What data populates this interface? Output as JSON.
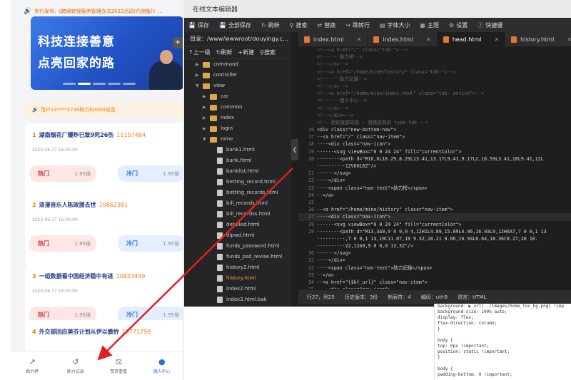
{
  "mobile": {
    "notice": "央行发布:《跨境转接服务管理办法2022活动(内测版)》...",
    "banner": {
      "line1": "科技连接善意",
      "line2": "点亮回家的路"
    },
    "winner": "用户13****2749助力60000成金",
    "cards": [
      {
        "num": "1",
        "title": "湖南烟花厂爆炸已致9死26伤",
        "hot": "11157484",
        "time": "2025-06-17 16:30:00",
        "left_label": "热门",
        "left_odds": "1.95倍",
        "right_label": "冷门",
        "right_odds": "1.95倍"
      },
      {
        "num": "2",
        "title": "浪漫音乐人陈政挪去世",
        "hot": "10862381",
        "time": "2025-06-17 16:30:00",
        "left_label": "热门",
        "left_odds": "1.95倍",
        "right_label": "冷门",
        "right_odds": "1.95倍"
      },
      {
        "num": "3",
        "title": "一组数据看中国经济稳中有进",
        "hot": "10823459",
        "time": "2025-06-17 16:30:00",
        "left_label": "热门",
        "left_odds": "1.95倍",
        "right_label": "冷门",
        "right_odds": "1.95倍"
      },
      {
        "num": "4",
        "title": "外交部回应美芬计划从伊以撤侨",
        "hot": "10771798",
        "time": "",
        "left_label": "",
        "left_odds": "",
        "right_label": "",
        "right_odds": ""
      }
    ],
    "tabs": [
      {
        "label": "助力榜",
        "icon": "trend-icon"
      },
      {
        "label": "助力记录",
        "icon": "history-icon"
      },
      {
        "label": "赞赏看看",
        "icon": "scale-icon"
      },
      {
        "label": "個人中心",
        "icon": "user-icon"
      }
    ]
  },
  "editor": {
    "window_title": "在线文本编辑器",
    "toolbar": [
      "保存",
      "全部保存",
      "刷新",
      "搜索",
      "替换",
      "跳转行",
      "字体大小",
      "主题",
      "设置",
      "快捷键"
    ],
    "directory": "目录：/www/wwwroot/douyingy.c...",
    "tree_actions": [
      "上一级",
      "刷新",
      "新建",
      "搜索"
    ],
    "tree": [
      {
        "name": "command",
        "type": "folder",
        "depth": 1
      },
      {
        "name": "controller",
        "type": "folder",
        "depth": 1
      },
      {
        "name": "view",
        "type": "folder-open",
        "depth": 1
      },
      {
        "name": "car",
        "type": "folder",
        "depth": 2
      },
      {
        "name": "common",
        "type": "folder",
        "depth": 2
      },
      {
        "name": "index",
        "type": "folder",
        "depth": 2
      },
      {
        "name": "login",
        "type": "folder",
        "depth": 2
      },
      {
        "name": "mine",
        "type": "folder-open",
        "depth": 2
      },
      {
        "name": "bank1.html",
        "type": "file",
        "depth": 3
      },
      {
        "name": "bank.html",
        "type": "file",
        "depth": 3
      },
      {
        "name": "banklist.html",
        "type": "file",
        "depth": 3
      },
      {
        "name": "betting_record.html",
        "type": "file",
        "depth": 3
      },
      {
        "name": "betting_records.html",
        "type": "file",
        "depth": 3
      },
      {
        "name": "bill_records.html",
        "type": "file",
        "depth": 3
      },
      {
        "name": "bill_recordss.html",
        "type": "file",
        "depth": 3
      },
      {
        "name": "detailed.html",
        "type": "file",
        "depth": 3
      },
      {
        "name": "dlpwd.html",
        "type": "file",
        "depth": 3
      },
      {
        "name": "funds_password.html",
        "type": "file",
        "depth": 3
      },
      {
        "name": "funds_psd_revise.html",
        "type": "file",
        "depth": 3
      },
      {
        "name": "history2.html",
        "type": "file",
        "depth": 3
      },
      {
        "name": "history.html",
        "type": "file-selected",
        "depth": 3
      },
      {
        "name": "index2.html",
        "type": "file",
        "depth": 3
      },
      {
        "name": "index3.html.bak",
        "type": "file",
        "depth": 3
      }
    ],
    "file_tabs": [
      {
        "name": "index.html",
        "active": false
      },
      {
        "name": "index.html",
        "active": false
      },
      {
        "name": "head.html",
        "active": true
      },
      {
        "name": "history.html",
        "active": false
      }
    ],
    "code": [
      {
        "n": "",
        "t": "<!--<a href=\"/\" class=\"tab-\">-->",
        "c": true
      },
      {
        "n": "",
        "t": "<!--····助力榜-->",
        "c": true
      },
      {
        "n": "",
        "t": "<!--</a>-->",
        "c": true
      },
      {
        "n": "",
        "t": "<!--<a href=\"/home/mine/history\" class=\"tab-\">-->",
        "c": true
      },
      {
        "n": "",
        "t": "<!--····助力記錄-->",
        "c": true
      },
      {
        "n": "",
        "t": "<!--</a>-->",
        "c": true
      },
      {
        "n": "",
        "t": "<!--<a href=\"/home/mine/index.html\" class=\"tab- active\">-->",
        "c": true
      },
      {
        "n": "",
        "t": "<!--····個人中心-->",
        "c": true
      },
      {
        "n": "",
        "t": "<!--</a>-->",
        "c": true
      },
      {
        "n": "",
        "t": "<!--</div>-->",
        "c": true
      },
      {
        "n": "",
        "t": "<!-- 新的底部导航 - 替换原有的 type-tab -->",
        "c": true
      },
      {
        "n": "16",
        "t": "<div class=\"new-bottom-nav\">",
        "c": false
      },
      {
        "n": "17",
        "t": "··<a href=\"/\" class=\"nav-item\">",
        "c": false
      },
      {
        "n": "18",
        "t": "····<div class=\"nav-icon\">",
        "c": false
      },
      {
        "n": "19",
        "t": "······<svg viewBox=\"0 0 24 24\" fill=\"currentColor\">",
        "c": false
      },
      {
        "n": "20",
        "t": "········<path d=\"M16,6L18.29,8.29L13.41,13.17L9.41,9.17L2,16.59L3.41,18L9.41,12L",
        "c": false
      },
      {
        "n": "",
        "t": "··········12V6H16Z\"/>",
        "c": false
      },
      {
        "n": "21",
        "t": "······</svg>",
        "c": false
      },
      {
        "n": "22",
        "t": "····</div>",
        "c": false
      },
      {
        "n": "23",
        "t": "····<span class=\"nav-text\">助力榜</span>",
        "c": false
      },
      {
        "n": "24",
        "t": "··</a>",
        "c": false
      },
      {
        "n": "25",
        "t": "",
        "c": false
      },
      {
        "n": "26",
        "t": "··<a href=\"/home/mine/history\" class=\"nav-item\">",
        "c": false
      },
      {
        "n": "27",
        "t": "····<div class=\"nav-icon\">",
        "c": false
      },
      {
        "n": "28",
        "t": "······<svg viewBox=\"0 0 24 24\" fill=\"currentColor\">",
        "c": false
      },
      {
        "n": "29",
        "t": "········<path d=\"M13,3A9,9 0 0,0 4,12H1L4.89,15.89L4.96,16.03L9,12H6A7,7 0 0,1 13",
        "c": false
      },
      {
        "n": "",
        "t": "··········,7 0 0,1 13,19C11.07,19 9.32,18.21 8.06,16.94L6.64,18.36C8.27,20 10.",
        "c": false
      },
      {
        "n": "",
        "t": "··········22,12A9,9 0 0,0 13,3Z\"/>",
        "c": false
      },
      {
        "n": "30",
        "t": "······</svg>",
        "c": false
      },
      {
        "n": "31",
        "t": "····</div>",
        "c": false
      },
      {
        "n": "32",
        "t": "····<span class=\"nav-text\">助力記錄</span>",
        "c": false
      },
      {
        "n": "33",
        "t": "··</a>",
        "c": false
      },
      {
        "n": "34",
        "t": "··<a href=\"{$kf_url}\" class=\"nav-item\">",
        "c": false
      },
      {
        "n": "35",
        "t": "····<div class=\"nav-icon\">",
        "c": false
      }
    ],
    "status": [
      "行27，列25",
      "历史版本：3份",
      "制表符：4",
      "编码：utf-8",
      "语言：HTML"
    ]
  },
  "devtools": [
    "background: ▶ url(../images/home_tov_bg.png) !imp",
    "background-size: 100% auto;",
    "display: flex;",
    "flex-direction: column;",
    "}",
    "",
    "body {",
    "  top: 0px !important;",
    "  position: static !important;",
    "}",
    "",
    "body {",
    "  padding-bottom: 0 !important;"
  ],
  "colors": {
    "accent_blue": "#2b6fd6",
    "hot_red": "#d33333",
    "arrow_red": "#e02020",
    "editor_bg": "#1e1e1e"
  }
}
